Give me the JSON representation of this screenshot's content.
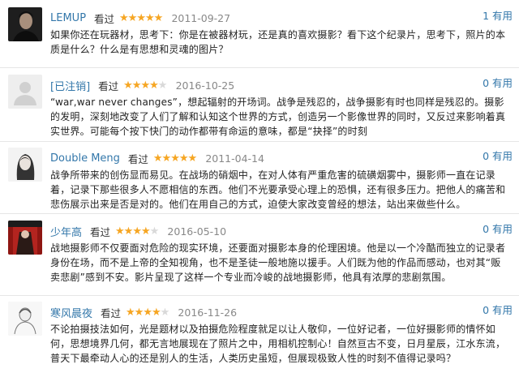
{
  "reviews": [
    {
      "user": "LEMUP",
      "seen_label": "看过",
      "rating": 5,
      "date": "2011-09-27",
      "useful": "1 有用",
      "avatar": "man-portrait-avatar",
      "content": "如果你还在玩器材，思考下：你是在被器材玩，还是真的喜欢摄影？看下这个纪录片，思考下，照片的本质是什么？什么是有思想和灵魂的图片？"
    },
    {
      "user": "[已注销]",
      "seen_label": "看过",
      "rating": 4,
      "date": "2016-10-25",
      "useful": "0 有用",
      "avatar": "default-user-avatar",
      "content": "“war,war never changes”，想起辐射的开场词。战争是残忍的，战争摄影有时也同样是残忍的。摄影的发明，深刻地改变了人们了解和认知这个世界的方式，创造另一个影像世界的同时，又反过来影响着真实世界。可能每个按下快门的动作都带有命运的意味，都是“抉择”的时刻"
    },
    {
      "user": "Double Meng",
      "seen_label": "看过",
      "rating": 5,
      "date": "2011-04-14",
      "useful": "0 有用",
      "avatar": "sketch-woman-avatar",
      "content": "战争所带来的创伤显而易见。在战场的硝烟中，在对人体有严重危害的硫磺烟雾中，摄影师一直在记录着，记录下那些很多人不愿相信的东西。他们不光要承受心理上的恐惧，还有很多压力。把他人的痛苦和悲伤展示出来是否是对的。他们在用自己的方式，迫使大家改变曾经的想法，站出来做些什么。"
    },
    {
      "user": "少年高",
      "seen_label": "看过",
      "rating": 4,
      "date": "2016-05-10",
      "useful": "0 有用",
      "avatar": "red-curtain-avatar",
      "content": "战地摄影师不仅要面对危险的现实环境，还要面对摄影本身的伦理困境。他是以一个冷酷而独立的记录者身份在场，而不是上帝的全知视角，也不是圣徒一般地施以援手。人们既为他的作品而感动，也对其“贩卖悲剧”感到不安。影片呈现了这样一个专业而冷峻的战地摄影师，他具有浓厚的悲剧氛围。"
    },
    {
      "user": "寒风晨夜",
      "seen_label": "看过",
      "rating": 4,
      "date": "2016-11-26",
      "useful": "0 有用",
      "avatar": "white-sketch-avatar",
      "content": "不论拍摄技法如何，光是题材以及拍摄危险程度就足以让人敬仰，一位好记者，一位好摄影师的情怀如何，思想境界几何，都无言地展现在了照片之中，用相机控制心！自然亘古不变，日月星辰，江水东流，普天下最牵动人心的还是别人的生活，人类历史虽短，但展现极致人性的时刻不值得记录吗？"
    }
  ]
}
